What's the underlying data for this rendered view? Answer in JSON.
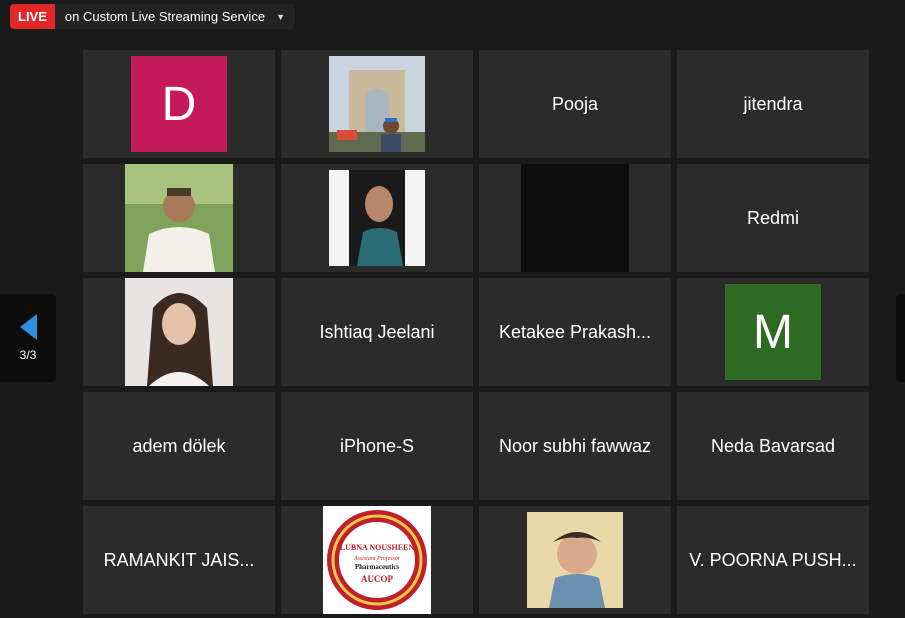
{
  "live": {
    "badge": "LIVE",
    "label": "on Custom Live Streaming Service"
  },
  "pager": {
    "count": "3/3"
  },
  "colors": {
    "live_red": "#e02828",
    "accent_blue": "#2e8ee0",
    "tile_bg": "#2b2b2b",
    "avatar_d": "#c41a5a",
    "avatar_m": "#2e6b22"
  },
  "tiles": [
    {
      "avatar_letter": "D"
    },
    {
      "photo_alt": ""
    },
    {
      "name": "Pooja"
    },
    {
      "name": "jitendra"
    },
    {
      "photo_alt": ""
    },
    {
      "photo_alt": ""
    },
    {
      "photo_alt": ""
    },
    {
      "name": "Redmi"
    },
    {
      "photo_alt": ""
    },
    {
      "name": "Ishtiaq Jeelani"
    },
    {
      "name": "Ketakee Prakash..."
    },
    {
      "avatar_letter": "M"
    },
    {
      "name": "adem dölek"
    },
    {
      "name": "iPhone-S"
    },
    {
      "name": "Noor subhi fawwaz"
    },
    {
      "name": "Neda Bavarsad"
    },
    {
      "name": "RAMANKIT JAIS..."
    },
    {
      "logo": {
        "line1": "LUBNA NOUSHEEN",
        "line2": "Assistant Professor",
        "line3": "Pharmaceutics",
        "line4": "AUCOP"
      }
    },
    {
      "photo_alt": ""
    },
    {
      "name": "V. POORNA PUSH..."
    }
  ]
}
